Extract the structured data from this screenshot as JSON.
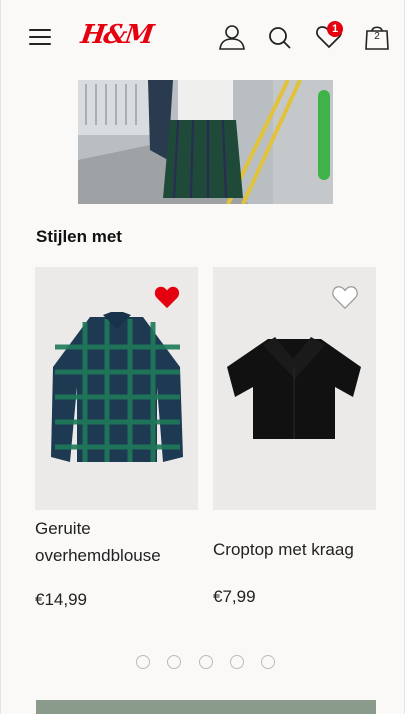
{
  "header": {
    "logo_text": "H&M",
    "wishlist_count": "1",
    "bag_count": "2",
    "accent_color": "#e50010"
  },
  "section": {
    "title": "Stijlen met"
  },
  "products": [
    {
      "name": "Geruite overhemdblouse",
      "price": "€14,99",
      "favorited": true
    },
    {
      "name": "Croptop met kraag",
      "price": "€7,99",
      "favorited": false
    }
  ],
  "carousel": {
    "page_count": 5
  },
  "icons": [
    "menu-icon",
    "account-icon",
    "search-icon",
    "heart-icon",
    "bag-icon"
  ]
}
